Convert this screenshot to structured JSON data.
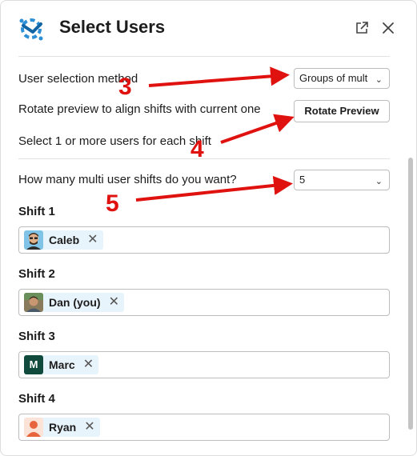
{
  "header": {
    "title": "Select Users",
    "logo_icon": "tool-logo-icon",
    "open_external_icon": "external-link-icon",
    "close_icon": "close-icon"
  },
  "form": {
    "selection_method": {
      "label": "User selection method",
      "value": "Groups of mult"
    },
    "rotate": {
      "label": "Rotate preview to align shifts with current one",
      "button": "Rotate Preview"
    },
    "select_hint": "Select 1 or more users for each shift",
    "count": {
      "label": "How many multi user shifts do you want?",
      "value": "5"
    },
    "shifts": [
      {
        "label": "Shift 1",
        "user": "Caleb"
      },
      {
        "label": "Shift 2",
        "user": "Dan (you)"
      },
      {
        "label": "Shift 3",
        "user": "Marc",
        "initial": "M"
      },
      {
        "label": "Shift 4",
        "user": "Ryan"
      }
    ]
  },
  "annotations": {
    "n3": "3",
    "n4": "4",
    "n5": "5",
    "color": "#e0120f"
  },
  "colors": {
    "chip_bg": "#e8f4fb",
    "marc_avatar": "#0f4a3c",
    "ryan_avatar": "#e8643c"
  }
}
